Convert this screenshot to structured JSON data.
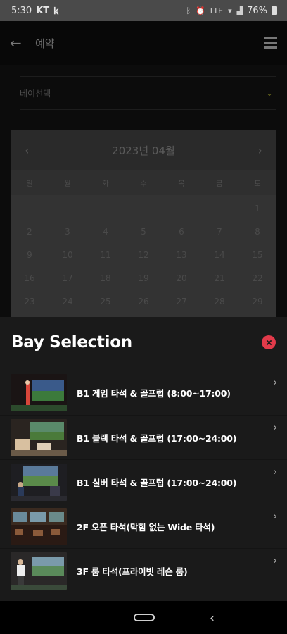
{
  "status_bar": {
    "time": "5:30",
    "carrier": "KT",
    "battery": "76%"
  },
  "header": {
    "title": "예약"
  },
  "bay_dropdown": {
    "placeholder": "베이선택"
  },
  "calendar": {
    "month": "2023년 04월",
    "weekdays": [
      "일",
      "월",
      "화",
      "수",
      "목",
      "금",
      "토"
    ],
    "days": [
      "",
      "",
      "",
      "",
      "",
      "",
      "1",
      "2",
      "3",
      "4",
      "5",
      "6",
      "7",
      "8",
      "9",
      "10",
      "11",
      "12",
      "13",
      "14",
      "15",
      "16",
      "17",
      "18",
      "19",
      "20",
      "21",
      "22",
      "23",
      "24",
      "25",
      "26",
      "27",
      "28",
      "29"
    ]
  },
  "sheet": {
    "title": "Bay Selection",
    "items": [
      {
        "label": "B1 게임 타석 & 골프럽 (8:00~17:00)"
      },
      {
        "label": "B1 블랙 타석 & 골프럽 (17:00~24:00)"
      },
      {
        "label": "B1 실버 타석 & 골프럽 (17:00~24:00)"
      },
      {
        "label": "2F 오픈 타석(막힘 없는 Wide 타석)"
      },
      {
        "label": "3F 룸 타석(프라이빗 레슨 룸)"
      }
    ]
  },
  "colors": {
    "accent_close": "#e23a4a",
    "sheet_bg": "#1a1a1a"
  }
}
